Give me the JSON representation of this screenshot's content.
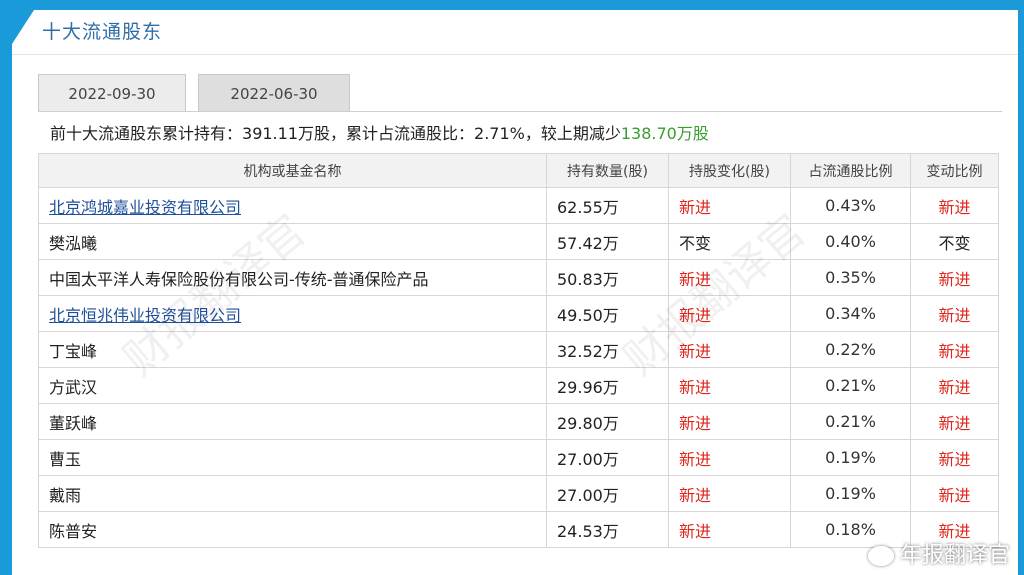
{
  "section": {
    "title": "十大流通股东"
  },
  "tabs": [
    {
      "label": "2022-09-30",
      "active": true
    },
    {
      "label": "2022-06-30",
      "active": false
    }
  ],
  "summary": {
    "prefix": "前十大流通股东累计持有：",
    "holding": "391.11万股",
    "ratio_label": "，累计占流通股比：",
    "ratio": "2.71%",
    "change_label": "，较上期减少",
    "change": "138.70万股"
  },
  "table": {
    "headers": [
      "机构或基金名称",
      "持有数量(股)",
      "持股变化(股)",
      "占流通股比例",
      "变动比例"
    ],
    "rows": [
      {
        "name": "北京鸿城嘉业投资有限公司",
        "link": true,
        "qty": "62.55万",
        "chg": "新进",
        "pct": "0.43%",
        "var": "新进"
      },
      {
        "name": "樊泓曦",
        "link": false,
        "qty": "57.42万",
        "chg": "不变",
        "pct": "0.40%",
        "var": "不变"
      },
      {
        "name": "中国太平洋人寿保险股份有限公司-传统-普通保险产品",
        "link": false,
        "qty": "50.83万",
        "chg": "新进",
        "pct": "0.35%",
        "var": "新进"
      },
      {
        "name": "北京恒兆伟业投资有限公司",
        "link": true,
        "qty": "49.50万",
        "chg": "新进",
        "pct": "0.34%",
        "var": "新进"
      },
      {
        "name": "丁宝峰",
        "link": false,
        "qty": "32.52万",
        "chg": "新进",
        "pct": "0.22%",
        "var": "新进"
      },
      {
        "name": "方武汉",
        "link": false,
        "qty": "29.96万",
        "chg": "新进",
        "pct": "0.21%",
        "var": "新进"
      },
      {
        "name": "董跃峰",
        "link": false,
        "qty": "29.80万",
        "chg": "新进",
        "pct": "0.21%",
        "var": "新进"
      },
      {
        "name": "曹玉",
        "link": false,
        "qty": "27.00万",
        "chg": "新进",
        "pct": "0.19%",
        "var": "新进"
      },
      {
        "name": "戴雨",
        "link": false,
        "qty": "27.00万",
        "chg": "新进",
        "pct": "0.19%",
        "var": "新进"
      },
      {
        "name": "陈普安",
        "link": false,
        "qty": "24.53万",
        "chg": "新进",
        "pct": "0.18%",
        "var": "新进"
      }
    ]
  },
  "watermark": {
    "text": "财报翻译官"
  },
  "weibo_watermark": {
    "text": "年报翻译官"
  },
  "colors": {
    "frame": "#1a9ad9",
    "title": "#2f6fa8",
    "new_entry": "#e0251b",
    "decrease": "#3a9d2f",
    "link": "#1f4f99"
  }
}
